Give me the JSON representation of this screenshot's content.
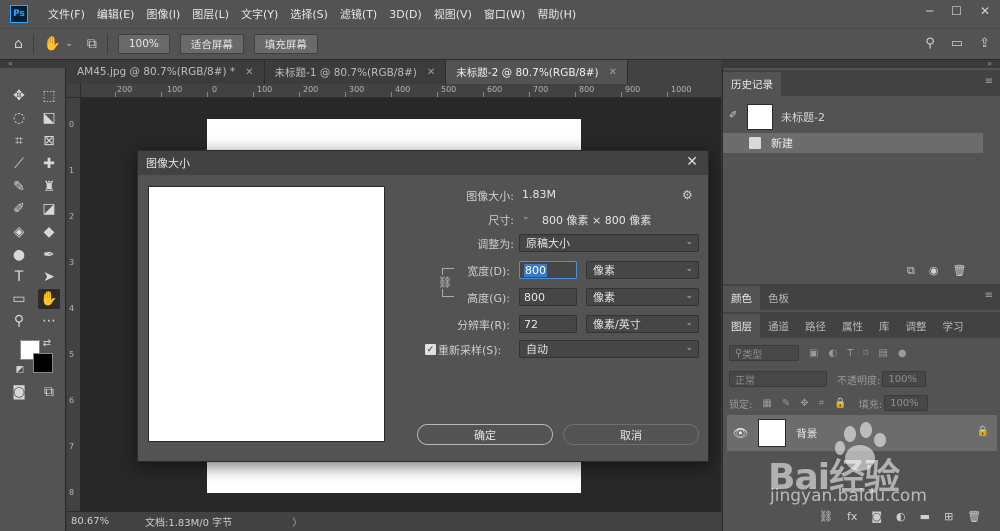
{
  "app": {
    "logo": "Ps"
  },
  "menu": [
    "文件(F)",
    "编辑(E)",
    "图像(I)",
    "图层(L)",
    "文字(Y)",
    "选择(S)",
    "滤镜(T)",
    "3D(D)",
    "视图(V)",
    "窗口(W)",
    "帮助(H)"
  ],
  "options": {
    "zoom": "100%",
    "fit_screen": "适合屏幕",
    "fill_screen": "填充屏幕"
  },
  "tabs": [
    {
      "label": "AM45.jpg @ 80.7%(RGB/8#) *"
    },
    {
      "label": "未标题-1 @ 80.7%(RGB/8#)"
    },
    {
      "label": "未标题-2 @ 80.7%(RGB/8#)"
    }
  ],
  "ruler": {
    "top": [
      "200",
      "100",
      "0",
      "100",
      "200",
      "300",
      "400",
      "500",
      "600",
      "700",
      "800",
      "900",
      "1000"
    ],
    "left": [
      "0",
      "1",
      "2",
      "3",
      "4",
      "5",
      "6",
      "7",
      "8"
    ]
  },
  "status": {
    "zoom": "80.67%",
    "doc_info": "文档:1.83M/0 字节",
    "arrow": "〉"
  },
  "dialog": {
    "title": "图像大小",
    "image_size_label": "图像大小:",
    "image_size_value": "1.83M",
    "dimensions_label": "尺寸:",
    "dimensions_value": "800 像素  ×  800 像素",
    "fit_label": "调整为:",
    "fit_value": "原稿大小",
    "width_label": "宽度(D):",
    "width_value": "800",
    "width_unit": "像素",
    "height_label": "高度(G):",
    "height_value": "800",
    "height_unit": "像素",
    "resolution_label": "分辨率(R):",
    "resolution_value": "72",
    "resolution_unit": "像素/英寸",
    "resample_label": "重新采样(S):",
    "resample_value": "自动",
    "ok": "确定",
    "cancel": "取消"
  },
  "history": {
    "tab": "历史记录",
    "snapshot": "未标题-2",
    "item": "新建"
  },
  "color_tabs": [
    "颜色",
    "色板"
  ],
  "layer_tabs": [
    "图层",
    "通道",
    "路径",
    "属性",
    "库",
    "调整",
    "学习"
  ],
  "layers": {
    "filter_kind": "类型",
    "blend_mode": "正常",
    "opacity_label": "不透明度:",
    "opacity_value": "100%",
    "lock_label": "锁定:",
    "fill_label": "填充:",
    "fill_value": "100%",
    "layer_name": "背景"
  },
  "watermark": {
    "text": "Bai经验",
    "url": "jingyan.baidu.com"
  }
}
